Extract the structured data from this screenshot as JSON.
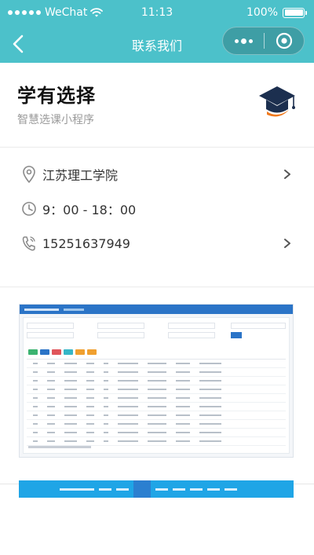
{
  "status_bar": {
    "carrier": "WeChat",
    "time": "11:13",
    "battery": "100%",
    "battery_level": 1.0,
    "signal_bars": 5
  },
  "nav": {
    "title": "联系我们",
    "back_icon": "chevron-left-icon",
    "more_icon": "more-dots-icon",
    "close_icon": "target-close-icon"
  },
  "brand": {
    "name": "学有选择",
    "subtitle": "智慧选课小程序",
    "logo_icon": "graduation-cap-icon"
  },
  "info_rows": [
    {
      "icon": "location-pin-icon",
      "text": "江苏理工学院",
      "has_arrow": true
    },
    {
      "icon": "clock-icon",
      "text": "9：00 - 18：00",
      "has_arrow": false
    },
    {
      "icon": "phone-icon",
      "text": "15251637949",
      "has_arrow": true
    }
  ],
  "colors": {
    "nav_bg": "#4cc1ca",
    "accent_blue": "#2b74c7",
    "logo_navy": "#1c2f4f",
    "logo_orange": "#f07a1f"
  }
}
